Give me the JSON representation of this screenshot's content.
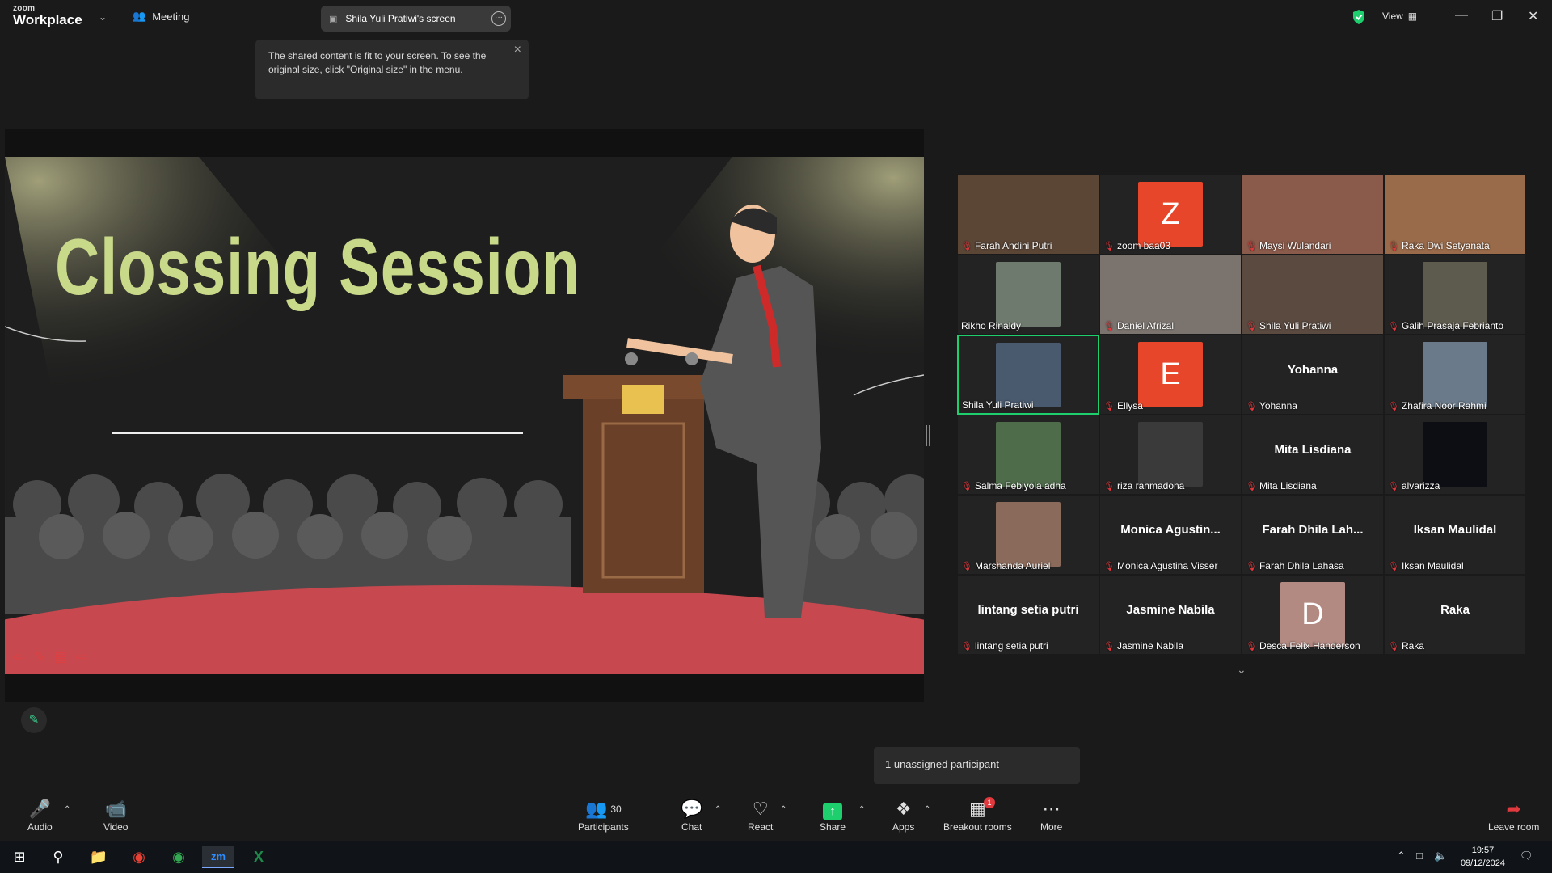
{
  "app": {
    "brand_small": "zoom",
    "brand_large": "Workplace"
  },
  "header": {
    "meeting_label": "Meeting",
    "screen_pill": "Shila Yuli Pratiwi's screen",
    "view_label": "View"
  },
  "tooltip": {
    "text": "The shared content is fit to your screen. To see the original size, click \"Original size\" in the menu."
  },
  "slide": {
    "title": "Clossing Session"
  },
  "gallery": [
    {
      "name": "Farah Andini Putri",
      "kind": "video",
      "color": "#5b4636"
    },
    {
      "name": "zoom baa03",
      "kind": "letter",
      "letter": "Z",
      "color": "#e8462a"
    },
    {
      "name": "Maysi Wulandari",
      "kind": "video",
      "color": "#8a5a4a"
    },
    {
      "name": "Raka Dwi Setyanata",
      "kind": "video",
      "color": "#9a6b4a"
    },
    {
      "name": "Rikho Rinaldy",
      "kind": "video",
      "color": "#6f7a6e"
    },
    {
      "name": "Daniel Afrizal",
      "kind": "video",
      "color": "#7b746e"
    },
    {
      "name": "Shila Yuli Pratiwi",
      "kind": "video",
      "color": "#5a4a40"
    },
    {
      "name": "Galih Prasaja Febrianto",
      "kind": "video",
      "color": "#5d5a4e"
    },
    {
      "name": "Shila Yuli Pratiwi",
      "kind": "video",
      "color": "#4a5a6e",
      "active": true
    },
    {
      "name": "Ellysa",
      "kind": "letter",
      "letter": "E",
      "color": "#e8462a"
    },
    {
      "name": "Yohanna",
      "kind": "name",
      "big": "Yohanna"
    },
    {
      "name": "Zhafira Noor Rahmi",
      "kind": "video",
      "color": "#6a7a8a"
    },
    {
      "name": "Salma Febiyola adha",
      "kind": "video",
      "color": "#4e6b4a"
    },
    {
      "name": "riza rahmadona",
      "kind": "video",
      "color": "#3a3a3a"
    },
    {
      "name": "Mita Lisdiana",
      "kind": "name",
      "big": "Mita Lisdiana"
    },
    {
      "name": "alvarizza",
      "kind": "video",
      "color": "#0d0d14"
    },
    {
      "name": "Marshanda Auriel",
      "kind": "video",
      "color": "#8a6a5a"
    },
    {
      "name": "Monica Agustina Visser",
      "kind": "name",
      "big": "Monica  Agustin..."
    },
    {
      "name": "Farah Dhila Lahasa",
      "kind": "name",
      "big": "Farah Dhila Lah..."
    },
    {
      "name": "Iksan Maulidal",
      "kind": "name",
      "big": "Iksan Maulidal"
    },
    {
      "name": "lintang setia putri",
      "kind": "name",
      "big": "lintang setia putri"
    },
    {
      "name": "Jasmine Nabila",
      "kind": "name",
      "big": "Jasmine Nabila"
    },
    {
      "name": "Desca Felix Handerson",
      "kind": "letter",
      "letter": "D",
      "color": "#b38a82"
    },
    {
      "name": "Raka",
      "kind": "name",
      "big": "Raka"
    }
  ],
  "notice": {
    "unassigned": "1 unassigned participant"
  },
  "toolbar": {
    "audio": "Audio",
    "video": "Video",
    "participants": "Participants",
    "participants_count": "30",
    "chat": "Chat",
    "react": "React",
    "share": "Share",
    "apps": "Apps",
    "breakout": "Breakout rooms",
    "breakout_badge": "1",
    "more": "More",
    "leave": "Leave room"
  },
  "taskbar": {
    "time": "19:57",
    "date": "09/12/2024"
  },
  "colors": {
    "accent_green": "#1ecf6e",
    "mute_red": "#e0393e",
    "slide_title": "#c9d98a",
    "avatar_orange": "#e8462a"
  }
}
